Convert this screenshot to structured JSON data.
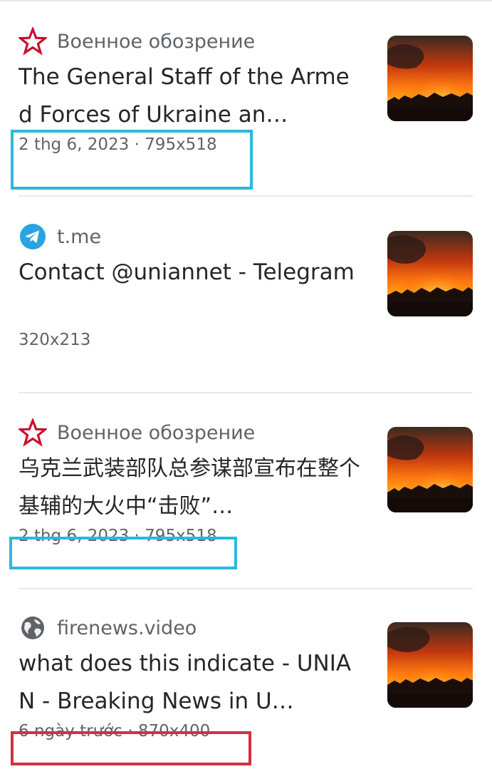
{
  "results": [
    {
      "source_icon": "red-star-icon",
      "source": "Военное обозрение",
      "title": "The General Staff of the Armed Forces of Ukraine an…",
      "meta": "2 thg 6, 2023 · 795x518",
      "thumb": "fire-night-thumbnail"
    },
    {
      "source_icon": "telegram-icon",
      "source": "t.me",
      "title": "Contact @uniannet - Telegram",
      "meta": "320x213",
      "thumb": "fire-night-thumbnail"
    },
    {
      "source_icon": "red-star-icon",
      "source": "Военное обозрение",
      "title": "乌克兰武装部队总参谋部宣布在整个基辅的大火中“击败”…",
      "meta": "2 thg 6, 2023 · 795x518",
      "thumb": "fire-night-thumbnail"
    },
    {
      "source_icon": "globe-icon",
      "source": "firenews.video",
      "title": "what does this indicate - UNIAN - Breaking News in U…",
      "meta": "6 ngày trước · 870x400",
      "thumb": "fire-night-thumbnail"
    }
  ],
  "annotation_colors": {
    "blue": "#29b9dc",
    "red": "#d5303d"
  }
}
